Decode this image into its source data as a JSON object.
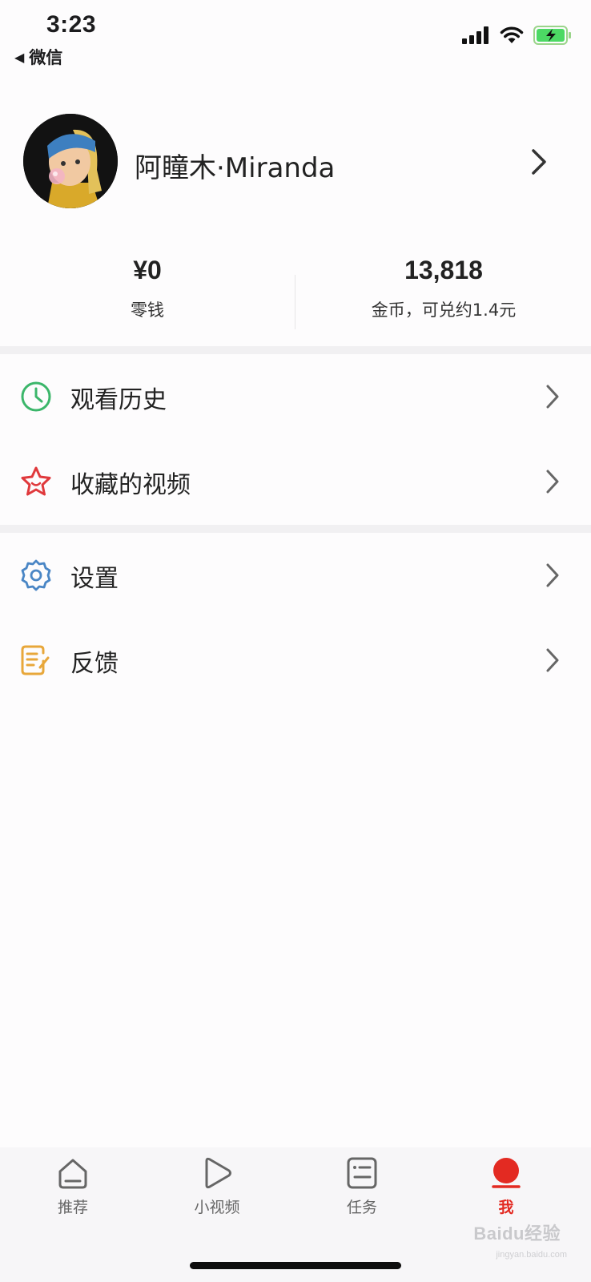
{
  "status_bar": {
    "time": "3:23",
    "back_label": "微信"
  },
  "profile": {
    "username": "阿瞳木·Miranda"
  },
  "stats": {
    "balance": {
      "value": "¥0",
      "label": "零钱"
    },
    "coins": {
      "value": "13,818",
      "label": "金币，可兑约1.4元"
    }
  },
  "menu": {
    "history": {
      "label": "观看历史",
      "icon": "clock-icon",
      "color": "#3bb66a"
    },
    "favorites": {
      "label": "收藏的视频",
      "icon": "star-icon",
      "color": "#e0393c"
    },
    "settings": {
      "label": "设置",
      "icon": "gear-icon",
      "color": "#4a86c5"
    },
    "feedback": {
      "label": "反馈",
      "icon": "note-edit-icon",
      "color": "#e8a73a"
    }
  },
  "tabbar": {
    "tabs": [
      {
        "label": "推荐",
        "icon": "home-icon",
        "active": false
      },
      {
        "label": "小视频",
        "icon": "play-icon",
        "active": false
      },
      {
        "label": "任务",
        "icon": "task-list-icon",
        "active": false
      },
      {
        "label": "我",
        "icon": "me-icon",
        "active": true
      }
    ],
    "active_color": "#e32a22"
  },
  "watermark": {
    "text": "Baidu经验",
    "sub": "jingyan.baidu.com"
  }
}
